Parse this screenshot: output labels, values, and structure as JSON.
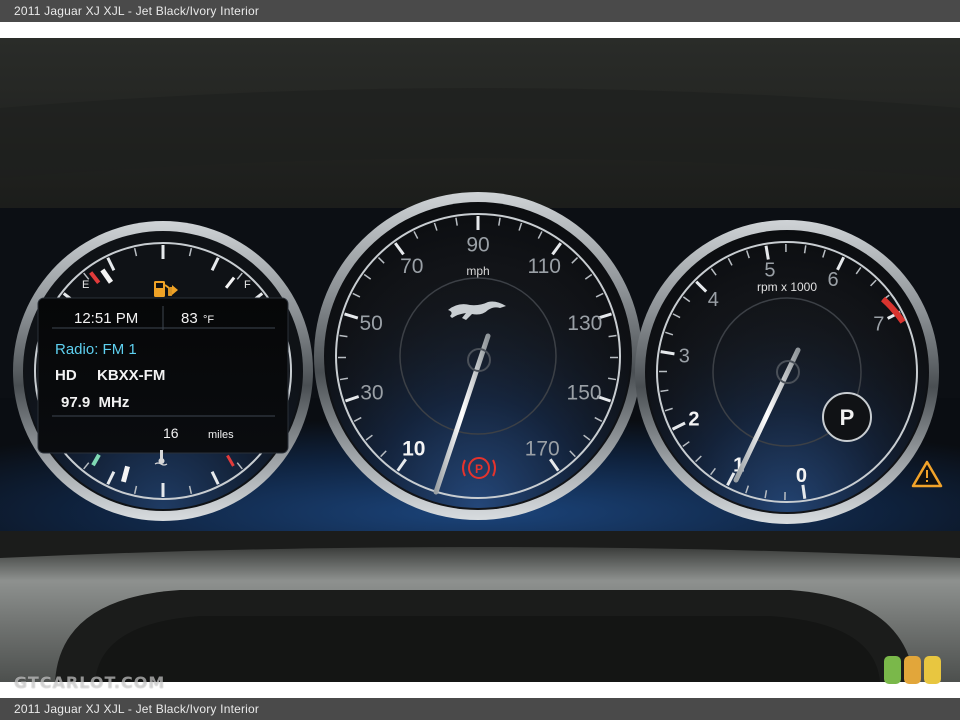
{
  "caption": {
    "top": "2011 Jaguar XJ XJL - Jet Black/Ivory Interior",
    "bottom": "2011 Jaguar XJ XJL - Jet Black/Ivory Interior"
  },
  "left_gauge": {
    "fuel_empty": "E",
    "fuel_full": "F",
    "time": "12:51 PM",
    "temperature": "83",
    "temp_unit": "°F",
    "radio_label": "Radio: FM 1",
    "hd_label": "HD",
    "station": "KBXX-FM",
    "frequency": "97.9  MHz",
    "range_value": "16",
    "range_unit": "miles",
    "icons": [
      "fuel-pump-icon",
      "coolant-temperature-icon"
    ]
  },
  "speedometer": {
    "unit": "mph",
    "labels": [
      "10",
      "30",
      "50",
      "70",
      "90",
      "110",
      "130",
      "150",
      "170"
    ],
    "icons": [
      "jaguar-leaper-logo",
      "parking-brake-warning-icon"
    ],
    "parking_brake_letter": "P"
  },
  "tachometer": {
    "unit": "rpm x 1000",
    "labels": [
      "0",
      "1",
      "2",
      "3",
      "4",
      "5",
      "6",
      "7"
    ],
    "gear": "P",
    "icons": [
      "warning-triangle-icon"
    ]
  },
  "watermark": {
    "text": "GTCARLOT.COM",
    "colors": [
      "#7ab84a",
      "#e2a63a",
      "#e8c640"
    ]
  }
}
